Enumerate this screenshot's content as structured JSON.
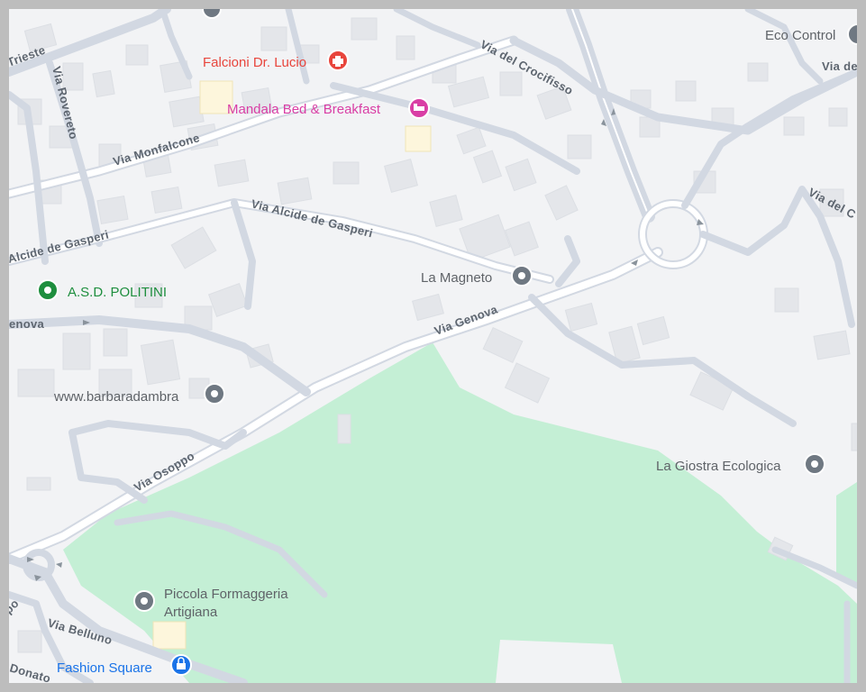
{
  "colors": {
    "background": "#f2f3f5",
    "park": "#c4efd5",
    "road": "#d2d8e2",
    "building": "#e6e7ea",
    "poi_default": "#6f7882",
    "poi_red": "#e8453c",
    "poi_pink": "#d93ea5",
    "poi_green": "#1e8e3e",
    "poi_blue": "#1a73e8"
  },
  "streets": {
    "trieste": "Trieste",
    "rovereto": "Via Rovereto",
    "monfalcone": "Via Monfalcone",
    "crocifisso": "Via del Crocifisso",
    "alcide_de_gasperi": "Via Alcide de Gasperi",
    "alcide_de_gasperi_west": "Alcide de Gasperi",
    "genova": "Via Genova",
    "genova_west": "enova",
    "osoppo": "Via Osoppo",
    "belluno": "Via Belluno",
    "via_de": "Via de",
    "via_del_c": "Via del C",
    "donato": "Donato",
    "po": "po"
  },
  "pois": {
    "falcioni": {
      "name": "Falcioni Dr. Lucio",
      "icon": "medical-cross-icon"
    },
    "mandala": {
      "name": "Mandala Bed & Breakfast",
      "icon": "bed-icon"
    },
    "eco_control": {
      "name": "Eco Control",
      "icon": "place-pin-icon"
    },
    "la_magneto": {
      "name": "La Magneto",
      "icon": "place-pin-icon"
    },
    "asd_politini": {
      "name": "A.S.D. POLITINI",
      "icon": "park-pin-icon"
    },
    "barbaradambra": {
      "name": "www.barbaradambra",
      "icon": "place-pin-icon"
    },
    "la_giostra": {
      "name": "La Giostra Ecologica",
      "icon": "place-pin-icon"
    },
    "piccola": {
      "name_line1": "Piccola Formaggeria",
      "name_line2": "Artigiana",
      "icon": "place-pin-icon"
    },
    "fashion_square": {
      "name": "Fashion Square",
      "icon": "shopping-bag-icon"
    }
  }
}
